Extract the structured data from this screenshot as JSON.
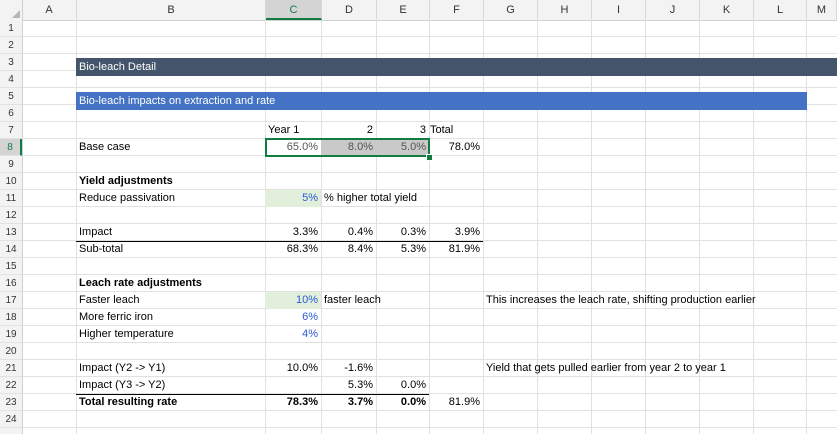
{
  "columns": [
    "A",
    "B",
    "C",
    "D",
    "E",
    "F",
    "G",
    "H",
    "I",
    "J",
    "K",
    "L",
    "M"
  ],
  "rows": [
    "1",
    "2",
    "3",
    "4",
    "5",
    "6",
    "7",
    "8",
    "9",
    "10",
    "11",
    "12",
    "13",
    "14",
    "15",
    "16",
    "17",
    "18",
    "19",
    "20",
    "21",
    "22",
    "23",
    "24"
  ],
  "selected_col": "C",
  "selected_row": "8",
  "colors": {
    "title_band": "#44546a",
    "section_band": "#4472c4",
    "input_fill": "#e2efda",
    "selected_fill": "#c9c9c9",
    "selection_border": "#107c41"
  },
  "title": "Bio-leach Detail",
  "section": "Bio-leach impacts on extraction and rate",
  "header": {
    "year1": "Year 1",
    "y2": "2",
    "y3": "3",
    "total": "Total"
  },
  "base": {
    "label": "Base case",
    "c": "65.0%",
    "d": "8.0%",
    "e": "5.0%",
    "f": "78.0%"
  },
  "yield": {
    "heading": "Yield adjustments",
    "passivation_label": "Reduce passivation",
    "passivation_value": "5%",
    "passivation_note": "% higher total yield"
  },
  "impact": {
    "label": "Impact",
    "c": "3.3%",
    "d": "0.4%",
    "e": "0.3%",
    "f": "3.9%"
  },
  "subtotal": {
    "label": "Sub-total",
    "c": "68.3%",
    "d": "8.4%",
    "e": "5.3%",
    "f": "81.9%"
  },
  "rate": {
    "heading": "Leach rate adjustments",
    "faster_label": "Faster leach",
    "faster_value": "10%",
    "faster_note": "faster leach",
    "faster_comment": "This increases the leach rate, shifting production earlier",
    "ferric_label": "More ferric iron",
    "ferric_value": "6%",
    "temp_label": "Higher temperature",
    "temp_value": "4%"
  },
  "impact21": {
    "label": "Impact (Y2 -> Y1)",
    "c": "10.0%",
    "d": "-1.6%",
    "comment": "Yield that gets pulled earlier from year 2 to year 1"
  },
  "impact22": {
    "label": "Impact (Y3 -> Y2)",
    "d": "5.3%",
    "e": "0.0%"
  },
  "total": {
    "label": "Total resulting rate",
    "c": "78.3%",
    "d": "3.7%",
    "e": "0.0%",
    "f": "81.9%"
  }
}
